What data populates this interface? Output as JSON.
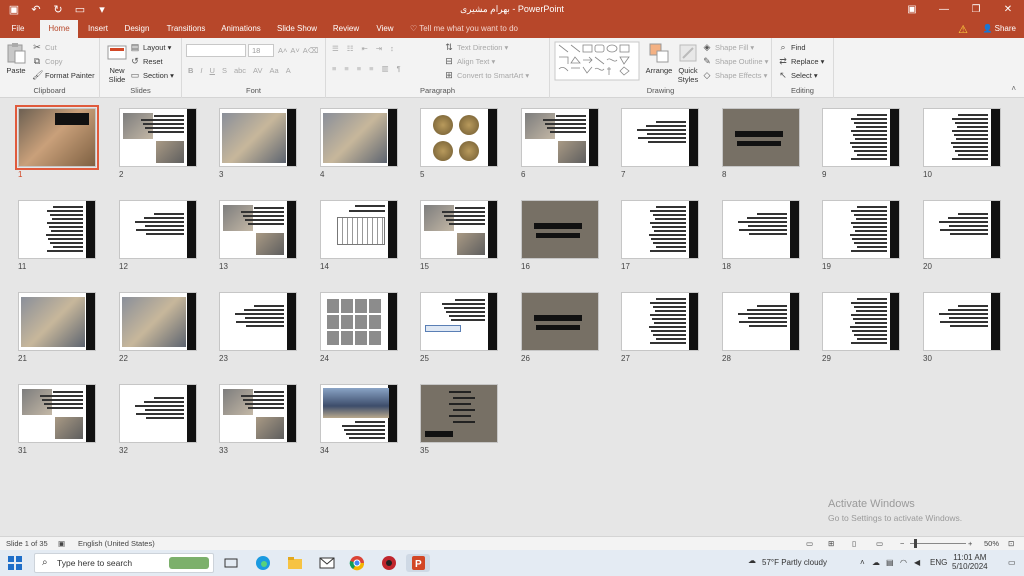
{
  "titlebar": {
    "title": "بهرام مشیری - PowerPoint",
    "qat": [
      "save-icon",
      "undo-icon",
      "redo-icon",
      "present-icon",
      "customize-icon"
    ],
    "window_controls": [
      "ribbon-display-icon",
      "minimize-icon",
      "restore-icon",
      "close-icon"
    ]
  },
  "tabs": [
    "File",
    "Home",
    "Insert",
    "Design",
    "Transitions",
    "Animations",
    "Slide Show",
    "Review",
    "View"
  ],
  "active_tab": "Home",
  "tell_me": "Tell me what you want to do",
  "share_label": "Share",
  "ribbon": {
    "clipboard": {
      "label": "Clipboard",
      "paste": "Paste",
      "cut": "Cut",
      "copy": "Copy",
      "format_painter": "Format Painter"
    },
    "slides": {
      "label": "Slides",
      "new_slide": "New Slide",
      "new_slide_sub": "Slide ▾",
      "layout": "Layout ▾",
      "reset": "Reset",
      "section": "Section ▾"
    },
    "font": {
      "label": "Font",
      "size": "18"
    },
    "paragraph": {
      "label": "Paragraph",
      "text_direction": "Text Direction ▾",
      "align_text": "Align Text ▾",
      "convert_smartart": "Convert to SmartArt ▾"
    },
    "drawing": {
      "label": "Drawing",
      "arrange": "Arrange",
      "quick_styles": "Quick Styles",
      "shape_fill": "Shape Fill ▾",
      "shape_outline": "Shape Outline ▾",
      "shape_effects": "Shape Effects ▾"
    },
    "editing": {
      "label": "Editing",
      "find": "Find",
      "replace": "Replace ▾",
      "select": "Select ▾"
    }
  },
  "slides": [
    {
      "n": "1",
      "kind": "photo",
      "selected": true
    },
    {
      "n": "2",
      "kind": "photo-text"
    },
    {
      "n": "3",
      "kind": "photo"
    },
    {
      "n": "4",
      "kind": "photo"
    },
    {
      "n": "5",
      "kind": "coins"
    },
    {
      "n": "6",
      "kind": "photo-text"
    },
    {
      "n": "7",
      "kind": "text"
    },
    {
      "n": "8",
      "kind": "gray"
    },
    {
      "n": "9",
      "kind": "dense"
    },
    {
      "n": "10",
      "kind": "dense"
    },
    {
      "n": "11",
      "kind": "dense"
    },
    {
      "n": "12",
      "kind": "text"
    },
    {
      "n": "13",
      "kind": "photo-text"
    },
    {
      "n": "14",
      "kind": "sketch"
    },
    {
      "n": "15",
      "kind": "photo-text"
    },
    {
      "n": "16",
      "kind": "gray"
    },
    {
      "n": "17",
      "kind": "dense"
    },
    {
      "n": "18",
      "kind": "text"
    },
    {
      "n": "19",
      "kind": "dense"
    },
    {
      "n": "20",
      "kind": "text"
    },
    {
      "n": "21",
      "kind": "photo"
    },
    {
      "n": "22",
      "kind": "photo"
    },
    {
      "n": "23",
      "kind": "text"
    },
    {
      "n": "24",
      "kind": "grid"
    },
    {
      "n": "25",
      "kind": "text-box"
    },
    {
      "n": "26",
      "kind": "gray"
    },
    {
      "n": "27",
      "kind": "dense"
    },
    {
      "n": "28",
      "kind": "text"
    },
    {
      "n": "29",
      "kind": "dense"
    },
    {
      "n": "30",
      "kind": "text"
    },
    {
      "n": "31",
      "kind": "photo-text"
    },
    {
      "n": "32",
      "kind": "text"
    },
    {
      "n": "33",
      "kind": "photo-text"
    },
    {
      "n": "34",
      "kind": "building"
    },
    {
      "n": "35",
      "kind": "gray-list"
    }
  ],
  "activate": {
    "title": "Activate Windows",
    "sub": "Go to Settings to activate Windows."
  },
  "status": {
    "slide": "Slide 1 of 35",
    "language": "English (United States)",
    "zoom": "50%"
  },
  "taskbar": {
    "search": "Type here to search",
    "weather": "57°F  Partly cloudy",
    "lang": "ENG",
    "time": "11:01 AM",
    "date": "5/10/2024"
  }
}
